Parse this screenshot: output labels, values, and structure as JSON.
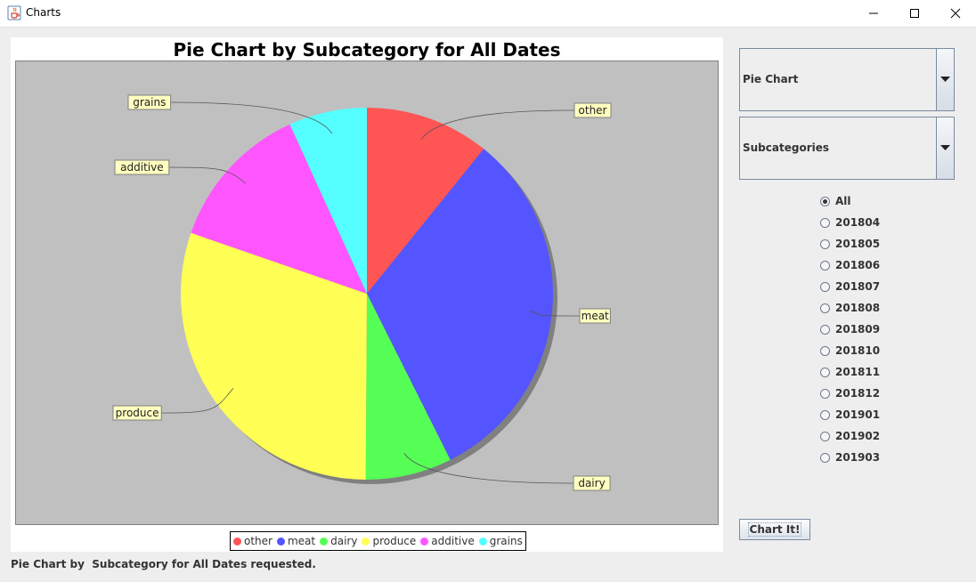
{
  "window": {
    "title": "Charts",
    "controls": [
      "minimize-icon",
      "maximize-icon",
      "close-icon"
    ]
  },
  "chart_data": {
    "type": "pie",
    "title": "Pie Chart by Subcategory for All Dates",
    "categories": [
      "other",
      "meat",
      "dairy",
      "produce",
      "additive",
      "grains"
    ],
    "values": [
      10.8,
      31.8,
      7.5,
      30.2,
      12.9,
      6.8
    ],
    "unit": "percent (estimated from slice angles)",
    "colors": [
      "#ff5555",
      "#5555ff",
      "#55ff55",
      "#ffff55",
      "#ff55ff",
      "#55ffff"
    ],
    "background": "#c0c0c0",
    "legend": "bottom",
    "labels_outside_with_leader_lines": true
  },
  "controls": {
    "chart_type_selected": "Pie Chart",
    "grouping_selected": "Subcategories",
    "date_options": [
      "All",
      "201804",
      "201805",
      "201806",
      "201807",
      "201808",
      "201809",
      "201810",
      "201811",
      "201812",
      "201901",
      "201902",
      "201903"
    ],
    "date_selected": "All",
    "chart_button": "Chart It!"
  },
  "status": "Pie Chart by  Subcategory for All Dates requested."
}
